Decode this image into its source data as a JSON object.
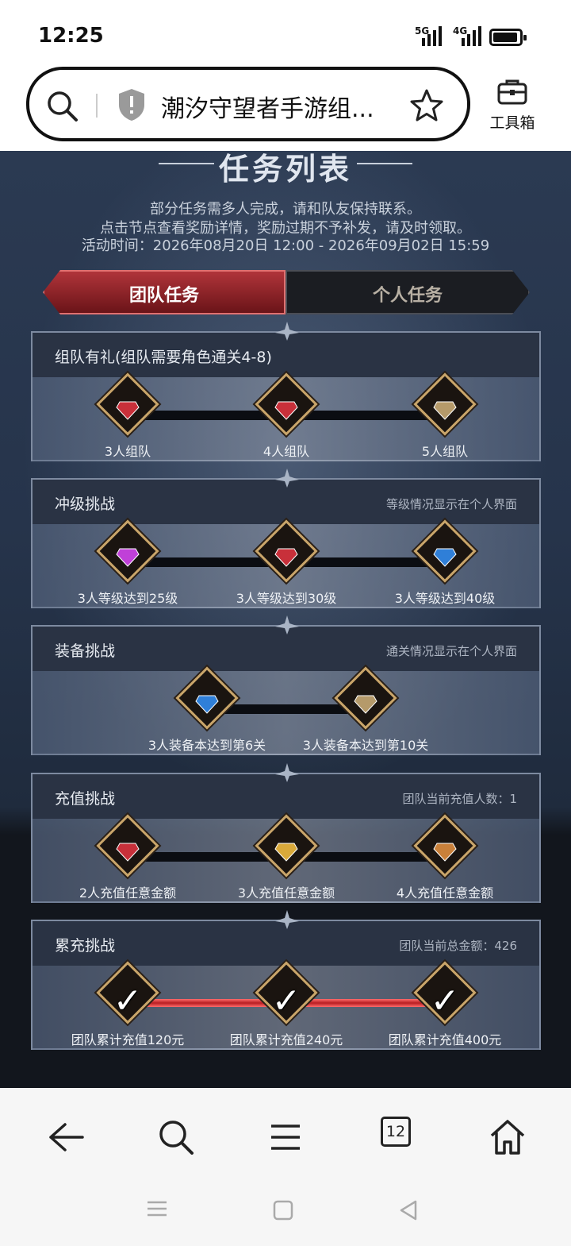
{
  "status": {
    "time": "12:25",
    "net1": "5G",
    "net2": "4G"
  },
  "browser": {
    "url_title": "潮汐守望者手游组...",
    "toolbox_label": "工具箱",
    "tab_count": "12"
  },
  "page": {
    "title": "任务列表",
    "desc_line1": "部分任务需多人完成，请和队友保持联系。",
    "desc_line2": "点击节点查看奖励详情，奖励过期不予补发，请及时领取。",
    "desc_line3": "活动时间：2026年08月20日 12:00 - 2026年09月02日 15:59",
    "tabs": [
      {
        "label": "团队任务",
        "active": true
      },
      {
        "label": "个人任务",
        "active": false
      }
    ],
    "panels": [
      {
        "title": "组队有礼(组队需要角色通关4-8)",
        "note": "",
        "nodes": [
          "3人组队",
          "4人组队",
          "5人组队"
        ],
        "icons": [
          "red-gem-icon",
          "red-gem-icon",
          "armor-icon"
        ],
        "completed": false
      },
      {
        "title": "冲级挑战",
        "note": "等级情况显示在个人界面",
        "nodes": [
          "3人等级达到25级",
          "3人等级达到30级",
          "3人等级达到40级"
        ],
        "icons": [
          "purple-crystal-icon",
          "red-gem-icon",
          "blue-gem-icon"
        ],
        "completed": false
      },
      {
        "title": "装备挑战",
        "note": "通关情况显示在个人界面",
        "nodes": [
          "3人装备本达到第6关",
          "3人装备本达到第10关"
        ],
        "icons": [
          "blue-gem-icon",
          "armor-icon"
        ],
        "completed": false
      },
      {
        "title": "充值挑战",
        "note": "团队当前充值人数：1",
        "nodes": [
          "2人充值任意金额",
          "3人充值任意金额",
          "4人充值任意金额"
        ],
        "icons": [
          "red-gem-icon",
          "gold-item-icon",
          "food-icon"
        ],
        "completed": false
      },
      {
        "title": "累充挑战",
        "note": "团队当前总金额：426",
        "nodes": [
          "团队累计充值120元",
          "团队累计充值240元",
          "团队累计充值400元"
        ],
        "icons": [
          "check-icon",
          "check-icon",
          "check-icon"
        ],
        "completed": true
      }
    ]
  },
  "colors": {
    "active_tab": "#b0343a",
    "progress_red": "#d32a2e",
    "node_border": "#c9a56a"
  }
}
